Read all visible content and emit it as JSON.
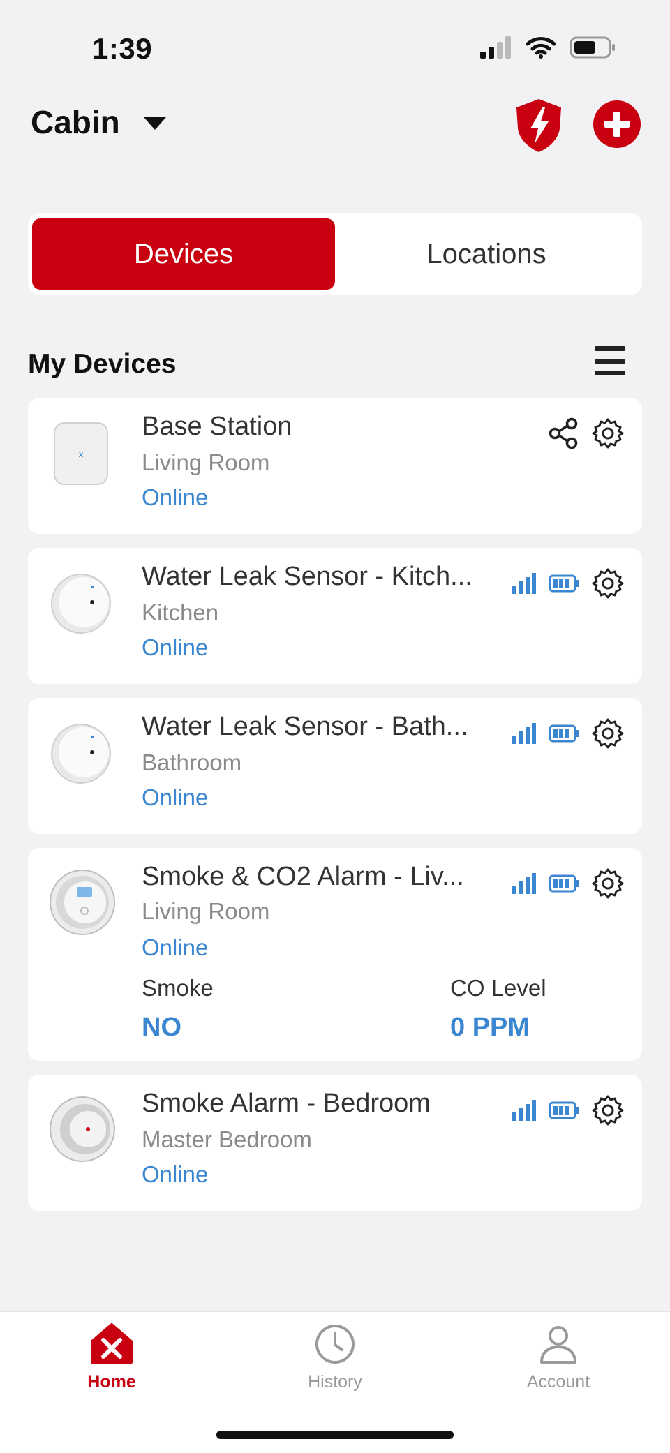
{
  "status_bar": {
    "time": "1:39"
  },
  "header": {
    "home_name": "Cabin"
  },
  "segments": [
    {
      "label": "Devices",
      "active": true
    },
    {
      "label": "Locations",
      "active": false
    }
  ],
  "section": {
    "title": "My Devices"
  },
  "devices": [
    {
      "name": "Base Station",
      "location": "Living Room",
      "status": "Online"
    },
    {
      "name": "Water Leak Sensor - Kitch...",
      "location": "Kitchen",
      "status": "Online"
    },
    {
      "name": "Water Leak Sensor - Bath...",
      "location": "Bathroom",
      "status": "Online"
    },
    {
      "name": "Smoke & CO2 Alarm - Liv...",
      "location": "Living Room",
      "status": "Online",
      "stats": [
        {
          "label": "Smoke",
          "value": "NO"
        },
        {
          "label": "CO Level",
          "value": "0 PPM"
        }
      ]
    },
    {
      "name": "Smoke Alarm - Bedroom",
      "location": "Master Bedroom",
      "status": "Online"
    }
  ],
  "tabs": [
    {
      "label": "Home",
      "icon": "home-icon",
      "active": true
    },
    {
      "label": "History",
      "icon": "clock-icon",
      "active": false
    },
    {
      "label": "Account",
      "icon": "person-icon",
      "active": false
    }
  ],
  "colors": {
    "accent": "#c8000f",
    "link": "#3a86d0",
    "background": "#f2f2f4"
  }
}
